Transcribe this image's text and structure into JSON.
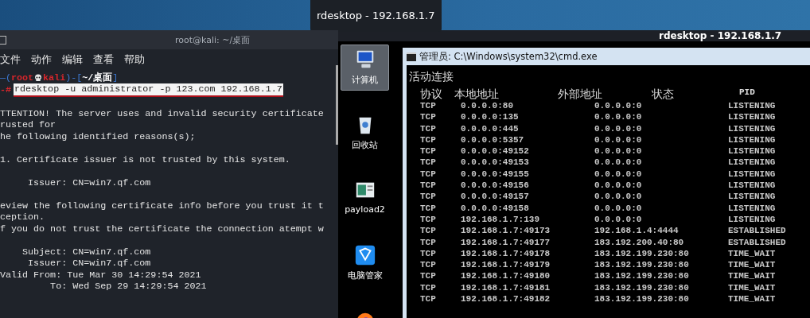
{
  "tooltip": "rdesktop - 192.168.1.7",
  "terminal": {
    "title": "root@kali: ~/桌面",
    "menu": [
      "文件",
      "动作",
      "编辑",
      "查看",
      "帮助"
    ],
    "prompt": {
      "open": "—(",
      "user": "root",
      "host": "kali",
      "mid": ")-[",
      "path": "~/桌面",
      "close": "]",
      "hash": "-#"
    },
    "command": "rdesktop -u administrator -p 123.com 192.168.1.7",
    "blocks": [
      [
        "TTENTION! The server uses and invalid security certificate",
        "rusted for",
        "he following identified reasons(s);"
      ],
      [
        "1. Certificate issuer is not trusted by this system."
      ],
      [
        "     Issuer: CN=win7.qf.com"
      ],
      [
        "eview the following certificate info before you trust it t",
        "ception.",
        "f you do not trust the certificate the connection atempt w"
      ],
      [
        "    Subject: CN=win7.qf.com",
        "     Issuer: CN=win7.qf.com",
        "Valid From: Tue Mar 30 14:29:54 2021",
        "         To: Wed Sep 29 14:29:54 2021"
      ]
    ]
  },
  "rdesktop": {
    "title": "rdesktop - 192.168.1.7",
    "desktop_icons": [
      {
        "kind": "computer",
        "label": "计算机",
        "selected": true
      },
      {
        "kind": "recycle",
        "label": "回收站",
        "selected": false
      },
      {
        "kind": "document",
        "label": "payload2",
        "selected": false
      },
      {
        "kind": "shield",
        "label": "电脑管家",
        "selected": false
      },
      {
        "kind": "browser",
        "selected": false
      }
    ],
    "cmd": {
      "title": "管理员: C:\\Windows\\system32\\cmd.exe",
      "heading": "活动连接",
      "columns": [
        "协议",
        "本地地址",
        "外部地址",
        "状态",
        "PID"
      ],
      "rows": [
        [
          "TCP",
          "0.0.0.0:80",
          "0.0.0.0:0",
          "LISTENING"
        ],
        [
          "TCP",
          "0.0.0.0:135",
          "0.0.0.0:0",
          "LISTENING"
        ],
        [
          "TCP",
          "0.0.0.0:445",
          "0.0.0.0:0",
          "LISTENING"
        ],
        [
          "TCP",
          "0.0.0.0:5357",
          "0.0.0.0:0",
          "LISTENING"
        ],
        [
          "TCP",
          "0.0.0.0:49152",
          "0.0.0.0:0",
          "LISTENING"
        ],
        [
          "TCP",
          "0.0.0.0:49153",
          "0.0.0.0:0",
          "LISTENING"
        ],
        [
          "TCP",
          "0.0.0.0:49155",
          "0.0.0.0:0",
          "LISTENING"
        ],
        [
          "TCP",
          "0.0.0.0:49156",
          "0.0.0.0:0",
          "LISTENING"
        ],
        [
          "TCP",
          "0.0.0.0:49157",
          "0.0.0.0:0",
          "LISTENING"
        ],
        [
          "TCP",
          "0.0.0.0:49158",
          "0.0.0.0:0",
          "LISTENING"
        ],
        [
          "TCP",
          "192.168.1.7:139",
          "0.0.0.0:0",
          "LISTENING"
        ],
        [
          "TCP",
          "192.168.1.7:49173",
          "192.168.1.4:4444",
          "ESTABLISHED"
        ],
        [
          "TCP",
          "192.168.1.7:49177",
          "183.192.200.40:80",
          "ESTABLISHED"
        ],
        [
          "TCP",
          "192.168.1.7:49178",
          "183.192.199.230:80",
          "TIME_WAIT"
        ],
        [
          "TCP",
          "192.168.1.7:49179",
          "183.192.199.230:80",
          "TIME_WAIT"
        ],
        [
          "TCP",
          "192.168.1.7:49180",
          "183.192.199.230:80",
          "TIME_WAIT"
        ],
        [
          "TCP",
          "192.168.1.7:49181",
          "183.192.199.230:80",
          "TIME_WAIT"
        ],
        [
          "TCP",
          "192.168.1.7:49182",
          "183.192.199.230:80",
          "TIME_WAIT"
        ]
      ]
    }
  }
}
